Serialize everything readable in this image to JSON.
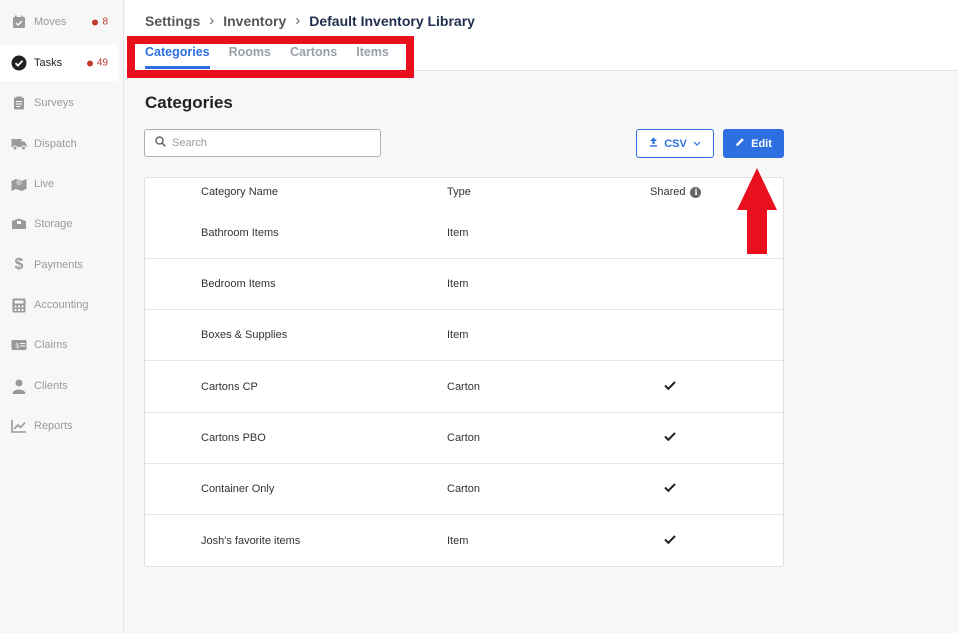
{
  "sidebar": {
    "items": [
      {
        "label": "Moves",
        "icon": "calendar-check-icon",
        "badge": "8"
      },
      {
        "label": "Tasks",
        "icon": "check-circle-icon",
        "badge": "49",
        "active": true
      },
      {
        "label": "Surveys",
        "icon": "clipboard-icon"
      },
      {
        "label": "Dispatch",
        "icon": "truck-icon"
      },
      {
        "label": "Live",
        "icon": "map-pin-icon"
      },
      {
        "label": "Storage",
        "icon": "box-icon"
      },
      {
        "label": "Payments",
        "icon": "dollar-icon"
      },
      {
        "label": "Accounting",
        "icon": "calculator-icon"
      },
      {
        "label": "Claims",
        "icon": "ticket-icon"
      },
      {
        "label": "Clients",
        "icon": "user-icon"
      },
      {
        "label": "Reports",
        "icon": "chart-line-icon"
      }
    ]
  },
  "breadcrumb": {
    "items": [
      "Settings",
      "Inventory",
      "Default Inventory Library"
    ]
  },
  "tabs": [
    "Categories",
    "Rooms",
    "Cartons",
    "Items"
  ],
  "page": {
    "title": "Categories",
    "search_placeholder": "Search",
    "csv_label": "CSV",
    "edit_label": "Edit"
  },
  "table": {
    "headers": {
      "name": "Category Name",
      "type": "Type",
      "shared": "Shared"
    },
    "rows": [
      {
        "name": "Bathroom Items",
        "type": "Item",
        "shared": false
      },
      {
        "name": "Bedroom Items",
        "type": "Item",
        "shared": false
      },
      {
        "name": "Boxes & Supplies",
        "type": "Item",
        "shared": false
      },
      {
        "name": "Cartons CP",
        "type": "Carton",
        "shared": true
      },
      {
        "name": "Cartons PBO",
        "type": "Carton",
        "shared": true
      },
      {
        "name": "Container Only",
        "type": "Carton",
        "shared": true
      },
      {
        "name": "Josh's favorite items",
        "type": "Item",
        "shared": true
      }
    ]
  },
  "colors": {
    "accent": "#2d6fe0",
    "annotation": "#e8101c",
    "badge": "#c0392b"
  }
}
